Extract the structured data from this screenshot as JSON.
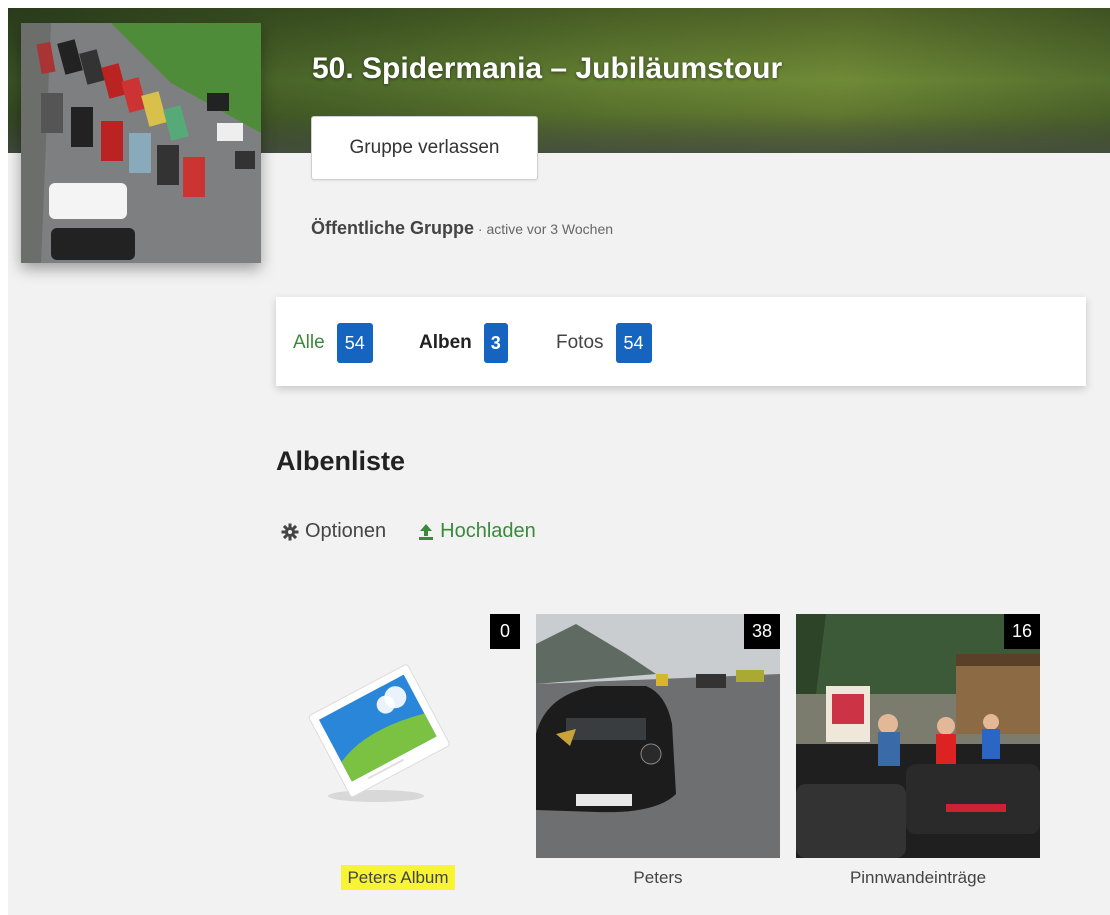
{
  "group": {
    "title": "50. Spidermania – Jubiläumstour",
    "leave_button": "Gruppe verlassen",
    "visibility": "Öffentliche Gruppe",
    "activity": " · active vor 3 Wochen"
  },
  "tabs": [
    {
      "label": "Alle",
      "count": "54"
    },
    {
      "label": "Alben",
      "count": "3"
    },
    {
      "label": "Fotos",
      "count": "54"
    }
  ],
  "section": {
    "heading": "Albenliste",
    "options_label": "Optionen",
    "upload_label": "Hochladen"
  },
  "albums": [
    {
      "name": "Peters Album",
      "count": "0",
      "highlighted": true,
      "thumbnail": "placeholder-image-icon"
    },
    {
      "name": "Peters",
      "count": "38",
      "thumbnail": "photo-black-car-on-road"
    },
    {
      "name": "Pinnwandeinträge",
      "count": "16",
      "thumbnail": "photo-cars-at-mountain-hut"
    }
  ],
  "colors": {
    "accent_green": "#3a8a3a",
    "badge_blue": "#1565c0",
    "highlight_yellow": "#f7f435"
  }
}
